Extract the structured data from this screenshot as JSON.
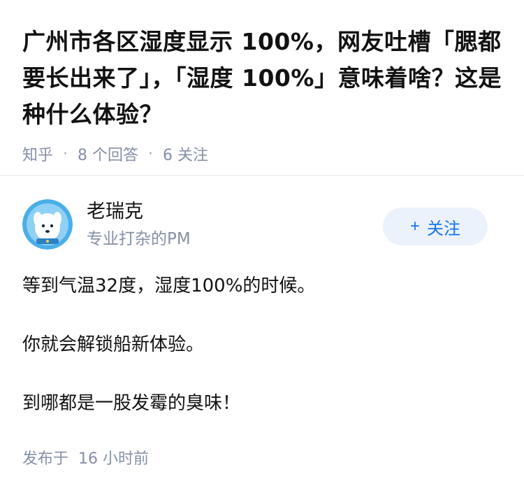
{
  "question": {
    "title": "广州市各区湿度显示 100%，网友吐槽「腮都要长出来了」，「湿度 100%」意味着啥？这是种什么体验？",
    "source": "知乎",
    "answers_count": "8 个回答",
    "followers_count": "6 关注"
  },
  "author": {
    "name": "老瑞克",
    "headline": "专业打杂的PM",
    "follow_icon": "plus",
    "follow_label": "关注"
  },
  "answer": {
    "paragraphs": [
      "等到气温32度，湿度100%的时候。",
      "你就会解锁船新体验。",
      "到哪都是一股发霉的臭味！"
    ],
    "published": "发布于  16 小时前"
  },
  "colors": {
    "accent": "#1772f6",
    "follow_bg": "#ebf2fb",
    "meta_gray": "#8590a6",
    "avatar_bg": "#4aaee8"
  }
}
